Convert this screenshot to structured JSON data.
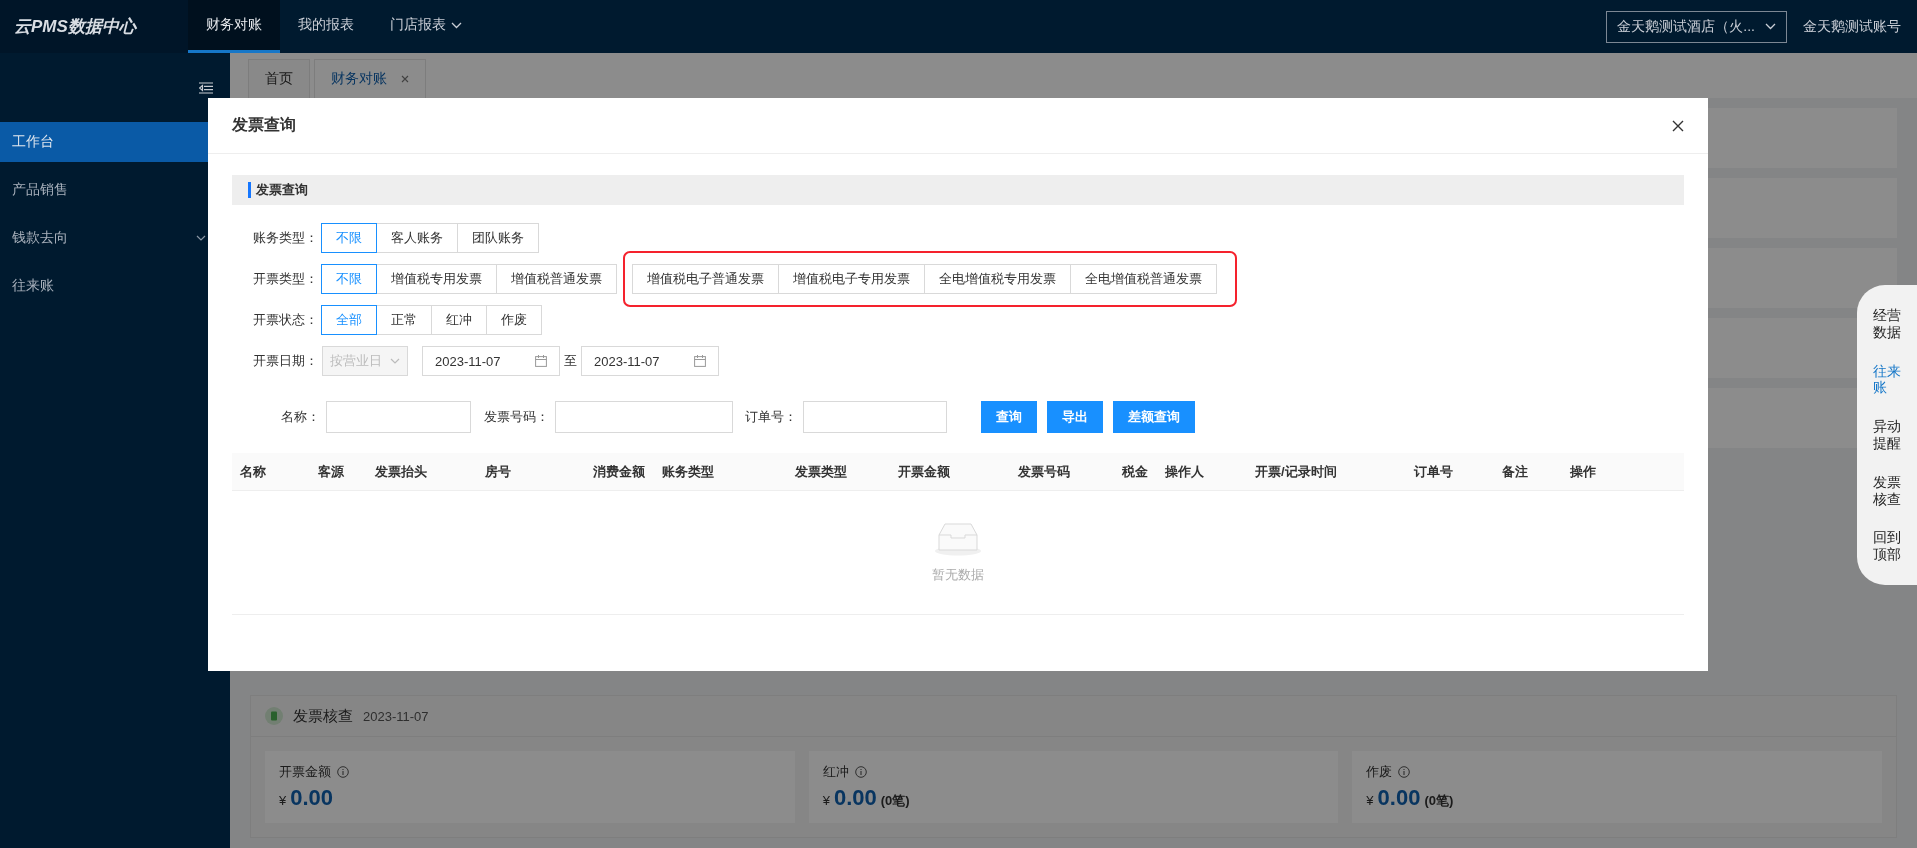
{
  "top_bar": {
    "logo": "云PMS数据中心",
    "nav": [
      {
        "label": "财务对账",
        "selected": true
      },
      {
        "label": "我的报表",
        "selected": false
      },
      {
        "label": "门店报表",
        "selected": false,
        "dropdown": true
      }
    ],
    "hotel_select": {
      "value": "金天鹅测试酒店（火..."
    },
    "account": "金天鹅测试账号"
  },
  "sidebar": {
    "items": [
      {
        "label": "工作台",
        "selected": true
      },
      {
        "label": "产品销售",
        "selected": false
      },
      {
        "label": "钱款去向",
        "selected": false,
        "expandable": true
      },
      {
        "label": "往来账",
        "selected": false
      }
    ]
  },
  "page_tabs": [
    {
      "label": "首页",
      "selected": false
    },
    {
      "label": "财务对账",
      "selected": true,
      "closable": true
    }
  ],
  "modal": {
    "title": "发票查询",
    "section_title": "发票查询",
    "filters": [
      {
        "label": "账务类型：",
        "options": [
          {
            "label": "不限",
            "selected": true
          },
          {
            "label": "客人账务",
            "selected": false
          },
          {
            "label": "团队账务",
            "selected": false
          }
        ]
      },
      {
        "label": "开票类型：",
        "options": [
          {
            "label": "不限",
            "selected": true
          },
          {
            "label": "增值税专用发票",
            "selected": false
          },
          {
            "label": "增值税普通发票",
            "selected": false
          }
        ],
        "highlighted_options": [
          {
            "label": "增值税电子普通发票",
            "selected": false
          },
          {
            "label": "增值税电子专用发票",
            "selected": false
          },
          {
            "label": "全电增值税专用发票",
            "selected": false
          },
          {
            "label": "全电增值税普通发票",
            "selected": false
          }
        ]
      },
      {
        "label": "开票状态：",
        "options": [
          {
            "label": "全部",
            "selected": true
          },
          {
            "label": "正常",
            "selected": false
          },
          {
            "label": "红冲",
            "selected": false
          },
          {
            "label": "作废",
            "selected": false
          }
        ]
      }
    ],
    "date_filter": {
      "label": "开票日期：",
      "mode": "按营业日",
      "mode_disabled": true,
      "start": "2023-11-07",
      "separator": "至",
      "end": "2023-11-07"
    },
    "search_fields": [
      {
        "label": "名称："
      },
      {
        "label": "发票号码："
      },
      {
        "label": "订单号："
      }
    ],
    "buttons": [
      "查询",
      "导出",
      "差额查询"
    ],
    "table": {
      "columns": [
        "名称",
        "客源",
        "发票抬头",
        "房号",
        "消费金额",
        "账务类型",
        "发票类型",
        "开票金额",
        "发票号码",
        "税金",
        "操作人",
        "开票/记录时间",
        "订单号",
        "备注",
        "操作"
      ],
      "empty_text": "暂无数据"
    }
  },
  "background_panel": {
    "title": "发票核查",
    "date": "2023-11-07",
    "cards": [
      {
        "label": "开票金额",
        "currency": "¥",
        "amount": "0.00"
      },
      {
        "label": "红冲",
        "currency": "¥",
        "amount": "0.00",
        "count": "(0笔)"
      },
      {
        "label": "作废",
        "currency": "¥",
        "amount": "0.00",
        "count": "(0笔)"
      }
    ]
  },
  "float_nav": [
    {
      "label": "经营数据",
      "selected": false
    },
    {
      "label": "往来账",
      "selected": true
    },
    {
      "label": "异动提醒",
      "selected": false
    },
    {
      "label": "发票核查",
      "selected": false
    },
    {
      "label": "回到顶部",
      "selected": false
    }
  ]
}
